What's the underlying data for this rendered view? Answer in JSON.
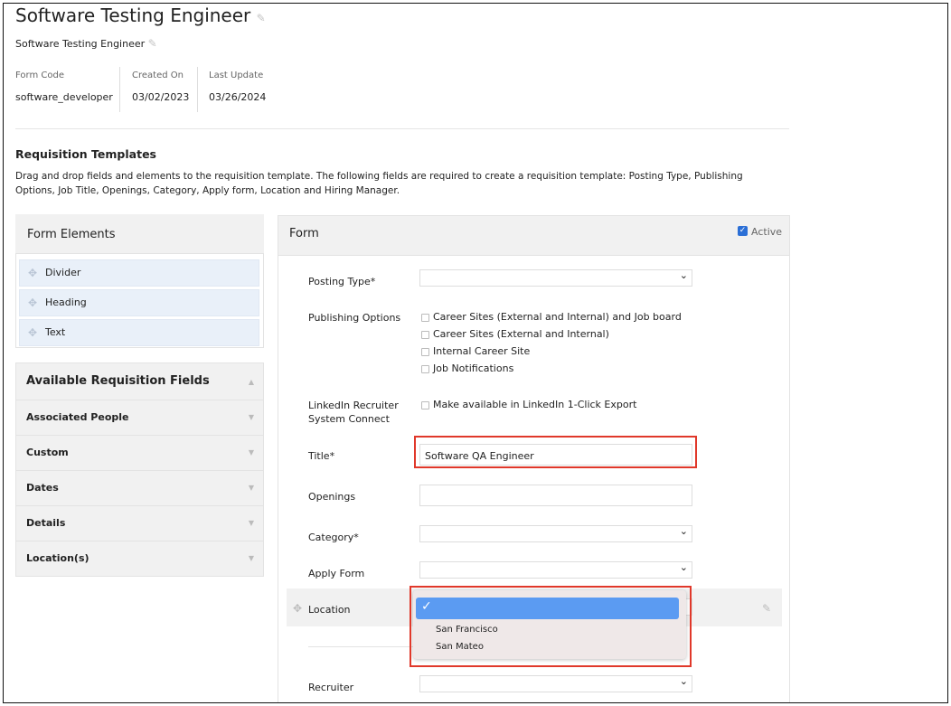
{
  "header": {
    "title": "Software Testing Engineer",
    "subtitle": "Software Testing Engineer",
    "meta": [
      {
        "label": "Form Code",
        "value": "software_developer"
      },
      {
        "label": "Created On",
        "value": "03/02/2023"
      },
      {
        "label": "Last Update",
        "value": "03/26/2024"
      }
    ]
  },
  "section": {
    "title": "Requisition Templates",
    "description": "Drag and drop fields and elements to the requisition template. The following fields are required to create a requisition template: Posting Type, Publishing Options, Job Title, Openings, Category, Apply form, Location and Hiring Manager."
  },
  "form_elements": {
    "title": "Form Elements",
    "items": [
      "Divider",
      "Heading",
      "Text"
    ]
  },
  "available_fields": {
    "title": "Available Requisition Fields",
    "groups": [
      "Associated People",
      "Custom",
      "Dates",
      "Details",
      "Location(s)"
    ]
  },
  "form": {
    "title": "Form",
    "active_label": "Active",
    "active_checked": true,
    "posting_type_label": "Posting Type*",
    "publishing_label": "Publishing Options",
    "publishing_options": [
      "Career Sites (External and Internal) and Job board",
      "Career Sites (External and Internal)",
      "Internal Career Site",
      "Job Notifications"
    ],
    "linkedin_label_1": "LinkedIn Recruiter",
    "linkedin_label_2": "System Connect",
    "linkedin_option": "Make available in LinkedIn 1-Click Export",
    "title_label": "Title*",
    "title_value": "Software QA Engineer",
    "openings_label": "Openings",
    "openings_value": "",
    "category_label": "Category*",
    "apply_form_label": "Apply Form",
    "location_label": "Location",
    "location_options": [
      "",
      "San Francisco",
      "San Mateo"
    ],
    "location_selected": "",
    "recruiter_label": "Recruiter"
  },
  "icons": {
    "edit": "pencil-icon",
    "drag": "drag-move-icon",
    "chevron": "chevron-down-icon",
    "check": "checkmark-icon"
  },
  "colors": {
    "accent": "#2b6fd6",
    "highlight_border": "#e0382a",
    "dropdown_selected": "#5b9bf2",
    "element_bg": "#e9f0f9"
  }
}
